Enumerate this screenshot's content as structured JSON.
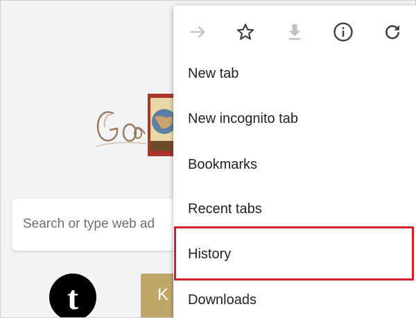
{
  "background": {
    "search_placeholder": "Search or type web ad",
    "shortcuts": [
      {
        "letter": "t",
        "color": "#000000"
      },
      {
        "letter": "K",
        "color": "#bfa76a"
      }
    ]
  },
  "menu": {
    "toolbar": [
      {
        "icon": "forward-arrow-icon"
      },
      {
        "icon": "star-icon"
      },
      {
        "icon": "download-icon"
      },
      {
        "icon": "info-icon"
      },
      {
        "icon": "refresh-icon"
      }
    ],
    "items": [
      {
        "label": "New tab"
      },
      {
        "label": "New incognito tab"
      },
      {
        "label": "Bookmarks"
      },
      {
        "label": "Recent tabs"
      },
      {
        "label": "History"
      },
      {
        "label": "Downloads"
      }
    ]
  },
  "colors": {
    "highlight": "#d11f2a",
    "menu_text": "#202124",
    "icon_active": "#5f6368",
    "icon_disabled": "#bdc1c6"
  }
}
